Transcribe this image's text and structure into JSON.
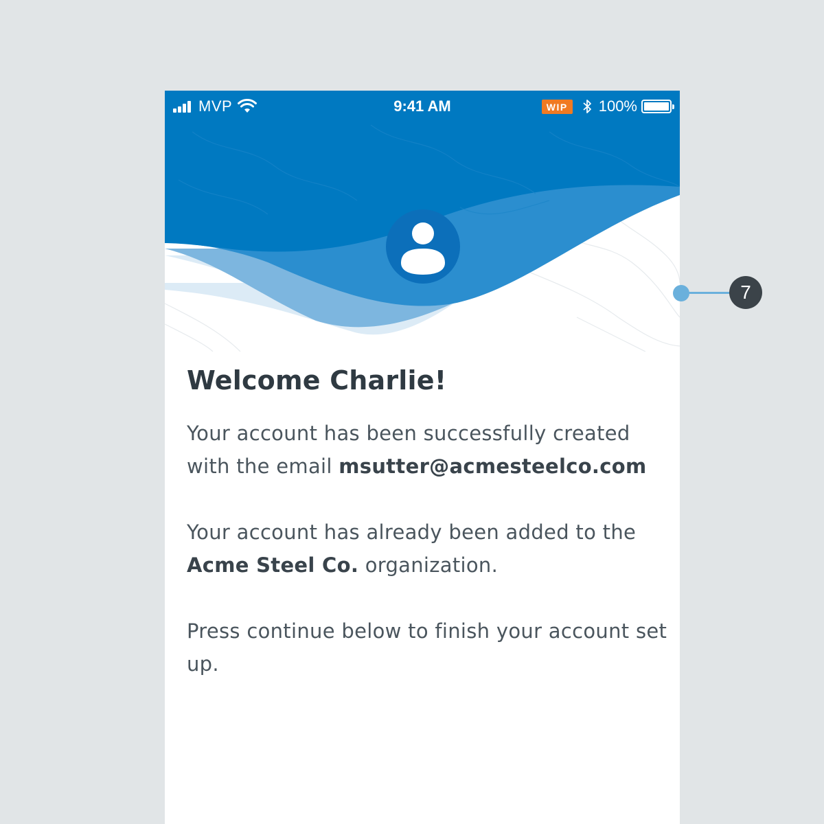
{
  "status_bar": {
    "carrier": "MVP",
    "time": "9:41 AM",
    "badge": "WIP",
    "battery": "100%",
    "icons": [
      "signal-bars-icon",
      "wifi-icon",
      "bluetooth-icon",
      "battery-icon"
    ]
  },
  "header": {
    "avatar_icon": "user-icon"
  },
  "content": {
    "title": "Welcome Charlie!",
    "p1_text": "Your account has been successfully created with the email ",
    "p1_email": "msutter@acmesteelco.com",
    "p2_text_before": "Your account has already been added to the ",
    "p2_org": "Acme Steel Co.",
    "p2_text_after": " organization.",
    "p3_text": "Press continue below to finish your account set up."
  },
  "annotation": {
    "number": "7"
  },
  "colors": {
    "brand_blue": "#0079c1",
    "background": "#e1e5e7",
    "wip_orange": "#f07a22",
    "annotation_dark": "#3b4349",
    "annotation_light": "#6ab0dc"
  }
}
